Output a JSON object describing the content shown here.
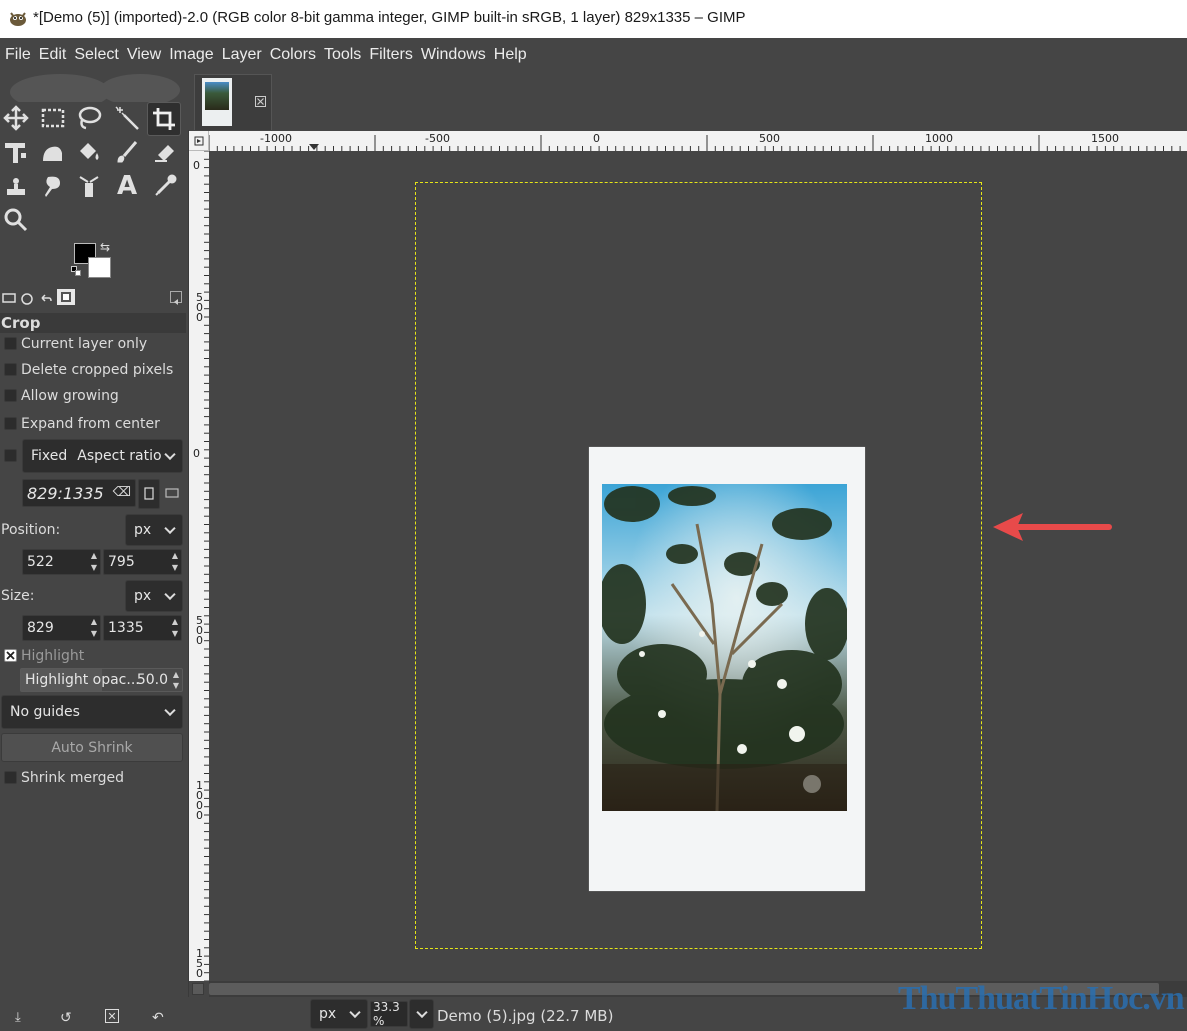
{
  "window": {
    "title": "*[Demo (5)] (imported)-2.0 (RGB color 8-bit gamma integer, GIMP built-in sRGB, 1 layer) 829x1335 – GIMP"
  },
  "menu": [
    "File",
    "Edit",
    "Select",
    "View",
    "Image",
    "Layer",
    "Colors",
    "Tools",
    "Filters",
    "Windows",
    "Help"
  ],
  "tools": [
    {
      "name": "move-tool-icon"
    },
    {
      "name": "rect-select-tool-icon"
    },
    {
      "name": "free-select-tool-icon"
    },
    {
      "name": "fuzzy-select-tool-icon"
    },
    {
      "name": "crop-tool-icon",
      "active": true
    },
    {
      "name": "unified-transform-tool-icon"
    },
    {
      "name": "warp-transform-tool-icon"
    },
    {
      "name": "bucket-fill-tool-icon"
    },
    {
      "name": "paintbrush-tool-icon"
    },
    {
      "name": "eraser-tool-icon"
    },
    {
      "name": "clone-tool-icon"
    },
    {
      "name": "smudge-tool-icon"
    },
    {
      "name": "paths-tool-icon"
    },
    {
      "name": "text-tool-icon"
    },
    {
      "name": "color-picker-tool-icon"
    },
    {
      "name": "zoom-tool-icon"
    }
  ],
  "colors": {
    "foreground": "#000000",
    "background": "#ffffff",
    "accent_arrow": "#e84a4a",
    "selection_dash": "#e6e617"
  },
  "tool_options": {
    "title": "Crop",
    "current_layer_only": {
      "label": "Current layer only",
      "checked": false
    },
    "delete_cropped_pixels": {
      "label": "Delete cropped pixels",
      "checked": false
    },
    "allow_growing": {
      "label": "Allow growing",
      "checked": false
    },
    "expand_from_center": {
      "label": "Expand from center",
      "checked": false
    },
    "fixed": {
      "label": "Fixed",
      "checked": false,
      "mode": "Aspect ratio"
    },
    "ratio_value": "829:1335",
    "position": {
      "label": "Position:",
      "unit": "px",
      "x": "522",
      "y": "795"
    },
    "size": {
      "label": "Size:",
      "unit": "px",
      "w": "829",
      "h": "1335"
    },
    "highlight": {
      "label": "Highlight",
      "checked": true
    },
    "highlight_opacity": {
      "label": "Highlight opac...",
      "value": "50.0"
    },
    "guides": "No guides",
    "auto_shrink": "Auto Shrink",
    "shrink_merged": {
      "label": "Shrink merged",
      "checked": false
    }
  },
  "ruler": {
    "h_labels": [
      "-1000",
      "-500",
      "0",
      "500",
      "1000",
      "1500"
    ],
    "v_labels": [
      "0",
      "500",
      "0",
      "500",
      "1000",
      "150"
    ]
  },
  "status": {
    "unit": "px",
    "zoom": "33.3 %",
    "file": "Demo (5).jpg (22.7 MB)"
  },
  "watermark": "ThuThuatTinHoc.vn"
}
